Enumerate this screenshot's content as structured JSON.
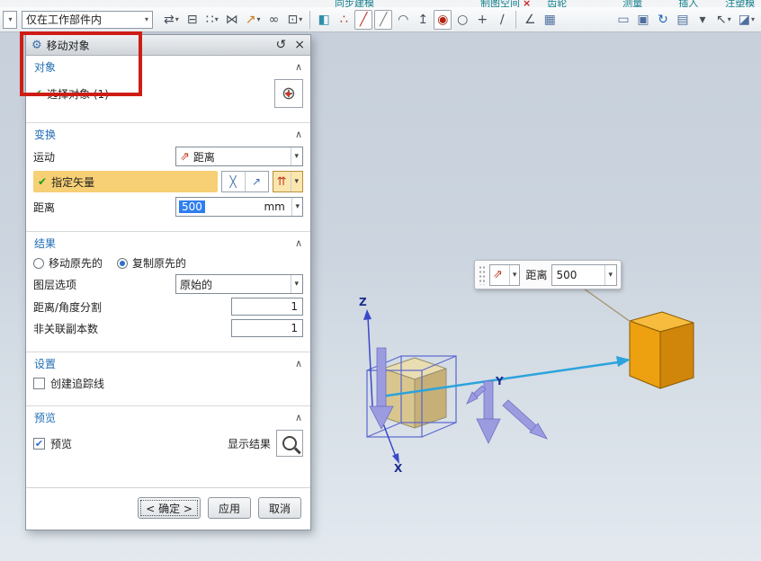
{
  "top_edge_fragments": [
    {
      "text": "同步建模"
    },
    {
      "text": "制图空间",
      "close": true
    },
    {
      "text": "齿轮"
    },
    {
      "text": "测量"
    },
    {
      "text": "插入"
    },
    {
      "text": "注塑模"
    }
  ],
  "toolbar": {
    "scope_value": "仅在工作部件内",
    "icons": [
      {
        "name": "assign-handle-icon",
        "glyph": "⇄",
        "dropdown": true
      },
      {
        "name": "copy-display-icon",
        "glyph": "⊟"
      },
      {
        "name": "pattern-geometry-icon",
        "glyph": "∷",
        "dropdown": true
      },
      {
        "name": "mirror-geometry-icon",
        "glyph": "⋈"
      },
      {
        "name": "promote-body-icon",
        "glyph": "↗",
        "color": "#cc7a1d",
        "dropdown": true
      },
      {
        "name": "interpart-link-icon",
        "glyph": "∞"
      },
      {
        "name": "extract-region-icon",
        "glyph": "⊡",
        "dropdown": true
      },
      {
        "sep": true
      },
      {
        "name": "shaded-cube-icon",
        "glyph": "◧",
        "color": "#2e8fa8"
      },
      {
        "name": "snap-point-icon",
        "glyph": "∴",
        "color": "#b73333"
      },
      {
        "name": "endpoint-snap-icon",
        "glyph": "╱",
        "color": "#b73333",
        "boxed": true
      },
      {
        "name": "midpoint-snap-icon",
        "glyph": "╱",
        "color": "#7d7d7d",
        "boxed": true
      },
      {
        "name": "arc-snap-icon",
        "glyph": "◠"
      },
      {
        "name": "point-on-curve-icon",
        "glyph": "↥"
      },
      {
        "name": "center-snap-icon",
        "glyph": "◉",
        "color": "#b02313",
        "boxed": true
      },
      {
        "name": "circle-snap-icon",
        "glyph": "○"
      },
      {
        "name": "intersection-snap-icon",
        "glyph": "+"
      },
      {
        "name": "slash-snap-icon",
        "glyph": "∕"
      },
      {
        "sep": true
      },
      {
        "name": "angle-snap-icon",
        "glyph": "∠"
      },
      {
        "name": "grid-icon",
        "glyph": "▦",
        "color": "#4d6f9d"
      },
      {
        "gap": true
      },
      {
        "name": "window-cascade-icon",
        "glyph": "▭",
        "color": "#4d6f9d"
      },
      {
        "name": "fit-window-icon",
        "glyph": "▣",
        "color": "#4d6f9d"
      },
      {
        "name": "rotate-view-icon",
        "glyph": "↻",
        "color": "#1f62bd"
      },
      {
        "name": "layer-manager-icon",
        "glyph": "▤",
        "color": "#4d6f9d"
      },
      {
        "name": "toolbar-overflow-icon",
        "glyph": "▾"
      },
      {
        "name": "selection-filter-icon",
        "glyph": "↖",
        "dropdown": true
      },
      {
        "name": "more-commands-icon",
        "glyph": "◪",
        "color": "#4d6f9d",
        "dropdown": true
      }
    ]
  },
  "icons": {
    "chevron_down": "▾",
    "collapse": "∧",
    "check": "✔",
    "gear": "⚙",
    "reset": "↺",
    "close": "×",
    "crosshair": "⊕",
    "vector_small": "⇗",
    "vector_multi": "⇈",
    "cross_swap": "╳",
    "vector_point": "↗"
  },
  "dialog": {
    "title": "移动对象",
    "object_section": {
      "header": "对象",
      "select_object_label": "选择对象 (1)"
    },
    "transform_section": {
      "header": "变换",
      "motion_label": "运动",
      "motion_value": "距离",
      "vector_label": "指定矢量",
      "distance_label": "距离",
      "distance_value": "500",
      "distance_unit": "mm"
    },
    "result_section": {
      "header": "结果",
      "radio_move": "移动原先的",
      "radio_copy": "复制原先的",
      "layer_label": "图层选项",
      "layer_value": "原始的",
      "division_label": "距离/角度分割",
      "division_value": "1",
      "copies_label": "非关联副本数",
      "copies_value": "1"
    },
    "settings_section": {
      "header": "设置",
      "trace_label": "创建追踪线"
    },
    "preview_section": {
      "header": "预览",
      "preview_label": "预览",
      "show_result_label": "显示结果"
    },
    "buttons": {
      "ok": "< 确定 >",
      "apply": "应用",
      "cancel": "取消"
    }
  },
  "viewport": {
    "mini_toolbar": {
      "distance_label": "距离",
      "distance_value": "500"
    },
    "axes": {
      "x": "X",
      "y": "Y",
      "z": "Z"
    }
  },
  "colors": {
    "annotation_red": "#ce1d15",
    "highlight_orange": "#f7cf74",
    "selection_blue": "#2f7ef0",
    "section_header_blue": "#1f6cb4",
    "check_green": "#19a019",
    "move_arrow_cyan": "#2ba3dc",
    "handle_purple": "#9b9ce0",
    "source_cube_tan": "#d9c68e",
    "target_cube_orange": "#eda010"
  }
}
